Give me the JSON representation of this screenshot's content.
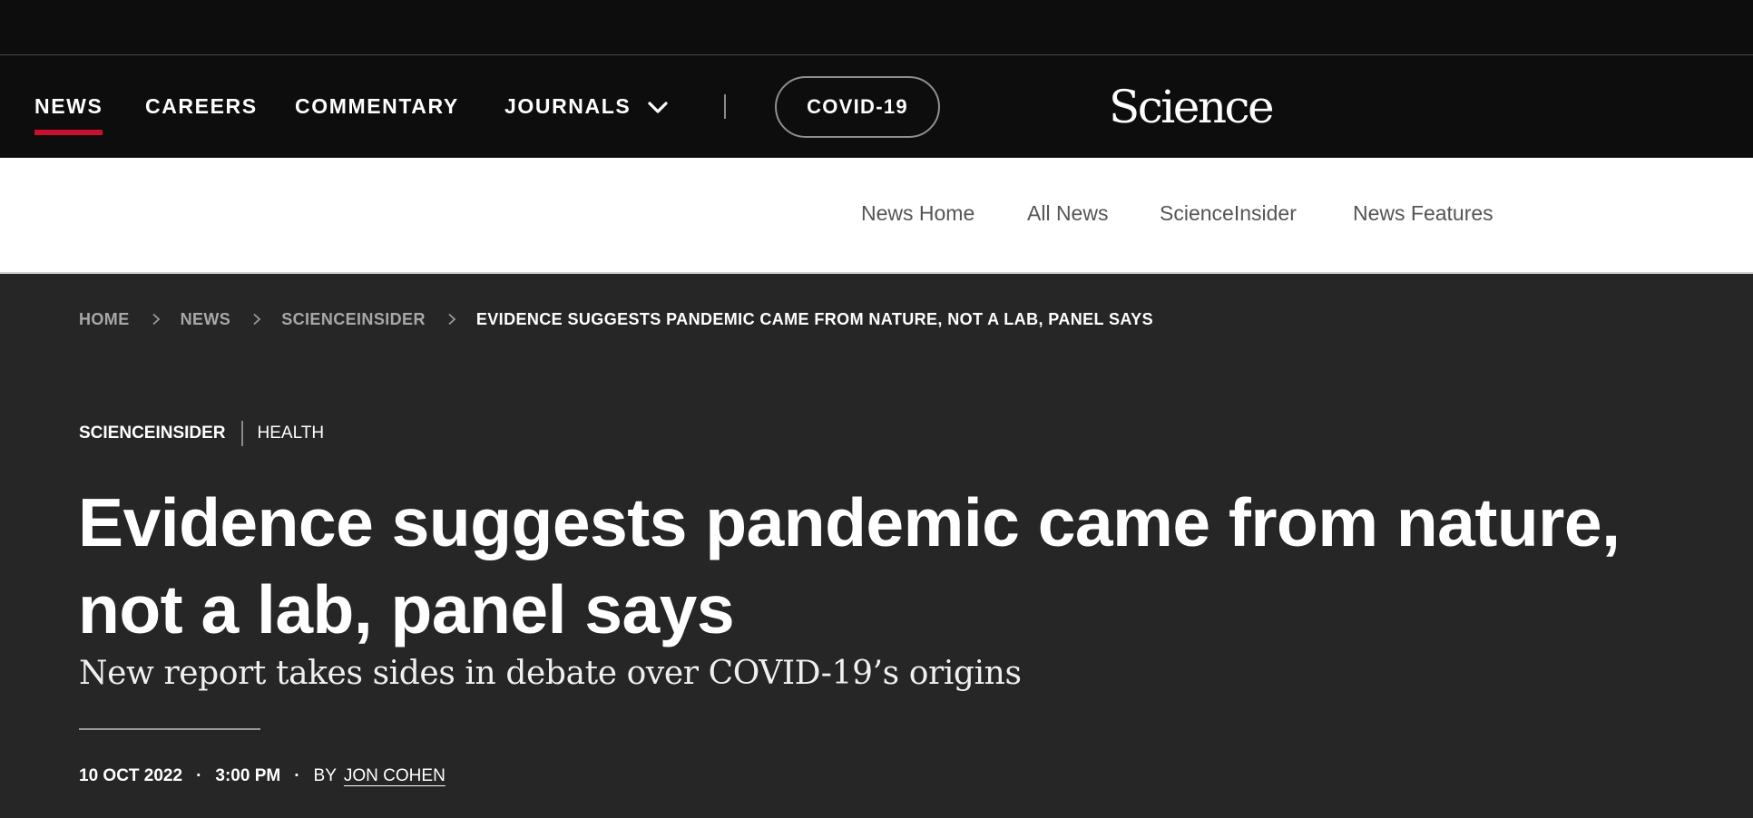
{
  "main_nav": {
    "items": [
      {
        "label": "NEWS",
        "active": true
      },
      {
        "label": "CAREERS"
      },
      {
        "label": "COMMENTARY"
      },
      {
        "label": "JOURNALS",
        "icon": "chevron-down-icon"
      }
    ],
    "covid_button": "COVID-19",
    "logo": "Science"
  },
  "sub_nav": {
    "items": [
      "News Home",
      "All News",
      "ScienceInsider",
      "News Features"
    ]
  },
  "breadcrumb": {
    "items": [
      "HOME",
      "NEWS",
      "SCIENCEINSIDER",
      "EVIDENCE SUGGESTS PANDEMIC CAME FROM NATURE, NOT A LAB, PANEL SAYS"
    ]
  },
  "article": {
    "section": "SCIENCEINSIDER",
    "topic": "HEALTH",
    "headline": "Evidence suggests pandemic came from nature, not a lab, panel says",
    "dek": "New report takes sides in debate over COVID-19’s origins",
    "date": "10 OCT 2022",
    "time": "3:00 PM",
    "byline_prefix": "BY",
    "author": "JON COHEN"
  },
  "colors": {
    "nav_bg": "#0d0d0d",
    "page_bg": "#262626",
    "accent_red": "#c8102e",
    "subnav_text": "#555555"
  }
}
